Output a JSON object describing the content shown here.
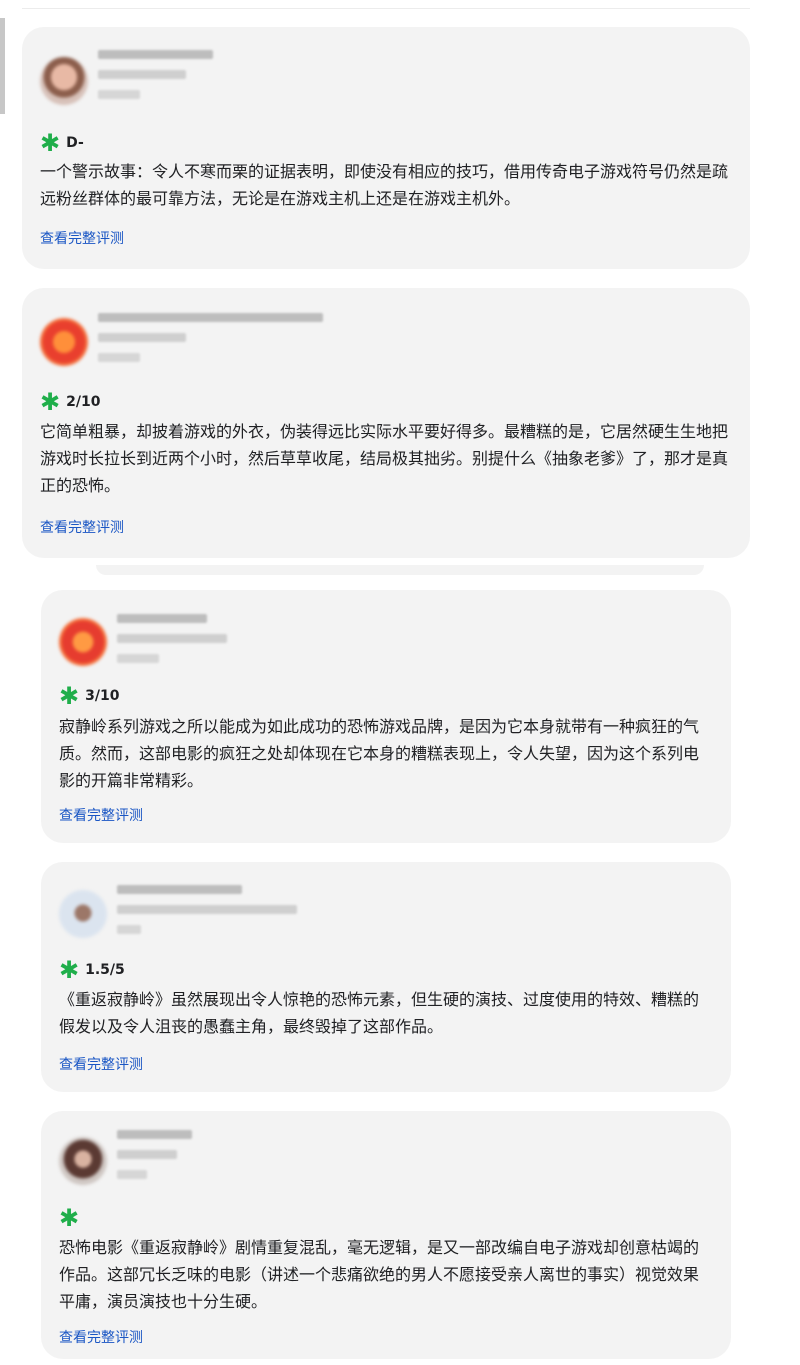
{
  "reviews": [
    {
      "rating": "D-",
      "quote": "一个警示故事：令人不寒而栗的证据表明，即使没有相应的技巧，借用传奇电子游戏符号仍然是疏远粉丝群体的最可靠方法，无论是在游戏主机上还是在游戏主机外。",
      "link": "查看完整评测"
    },
    {
      "rating": "2/10",
      "quote": "它简单粗暴，却披着游戏的外衣，伪装得远比实际水平要好得多。最糟糕的是，它居然硬生生地把游戏时长拉长到近两个小时，然后草草收尾，结局极其拙劣。别提什么《抽象老爹》了，那才是真正的恐怖。",
      "link": "查看完整评测"
    },
    {
      "rating": "3/10",
      "quote": "寂静岭系列游戏之所以能成为如此成功的恐怖游戏品牌，是因为它本身就带有一种疯狂的气质。然而，这部电影的疯狂之处却体现在它本身的糟糕表现上，令人失望，因为这个系列电影的开篇非常精彩。",
      "link": "查看完整评测"
    },
    {
      "rating": "1.5/5",
      "quote": "《重返寂静岭》虽然展现出令人惊艳的恐怖元素，但生硬的演技、过度使用的特效、糟糕的假发以及令人沮丧的愚蠢主角，最终毁掉了这部作品。",
      "link": "查看完整评测"
    },
    {
      "rating": "",
      "quote": "恐怖电影《重返寂静岭》剧情重复混乱，毫无逻辑，是又一部改编自电子游戏却创意枯竭的作品。这部冗长乏味的电影（讲述一个悲痛欲绝的男人不愿接受亲人离世的事实）视觉效果平庸，演员演技也十分生硬。",
      "link": "查看完整评测"
    }
  ],
  "icons": {
    "rating": "green-asterisk-icon"
  },
  "colors": {
    "card": "#f3f3f3",
    "link": "#1a56c4",
    "star": "#1fae4a"
  }
}
